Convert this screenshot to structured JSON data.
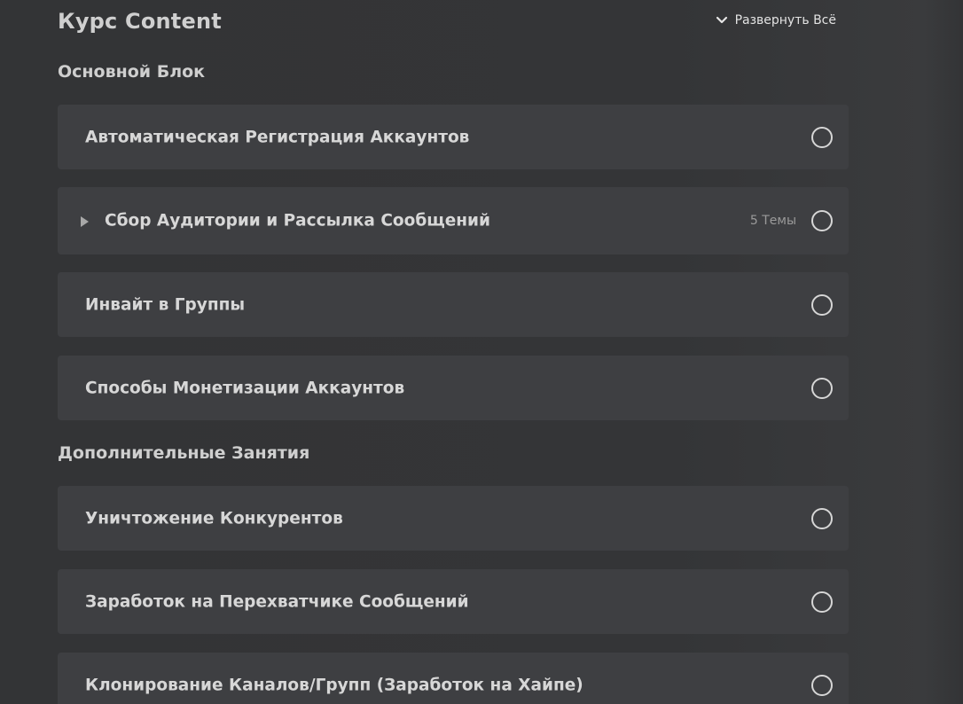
{
  "header": {
    "title": "Курс Content",
    "expand_all_label": "Развернуть Всё"
  },
  "sections": [
    {
      "title": "Основной Блок",
      "lessons": [
        {
          "title": "Автоматическая Регистрация Аккаунтов",
          "completed": false
        },
        {
          "title": "Сбор Аудитории и Рассылка Сообщений",
          "topics_count": "5 Темы",
          "expandable": true,
          "completed": false
        },
        {
          "title": "Инвайт в Группы",
          "completed": false
        },
        {
          "title": "Способы Монетизации Аккаунтов",
          "completed": false
        }
      ]
    },
    {
      "title": "Дополнительные Занятия",
      "lessons": [
        {
          "title": "Уничтожение Конкурентов",
          "completed": false
        },
        {
          "title": "Заработок на Перехватчике Сообщений",
          "completed": false
        },
        {
          "title": "Клонирование Каналов/Групп (Заработок на Хайпе)",
          "completed": false
        }
      ]
    }
  ],
  "icons": {
    "expand_all": "chevron-down-icon",
    "expand_lesson": "caret-right-icon",
    "status": "empty-circle-icon"
  },
  "colors": {
    "background": "#333436",
    "card": "#3e3f42",
    "text": "#d7d7d7",
    "muted": "#9a9a9a"
  }
}
